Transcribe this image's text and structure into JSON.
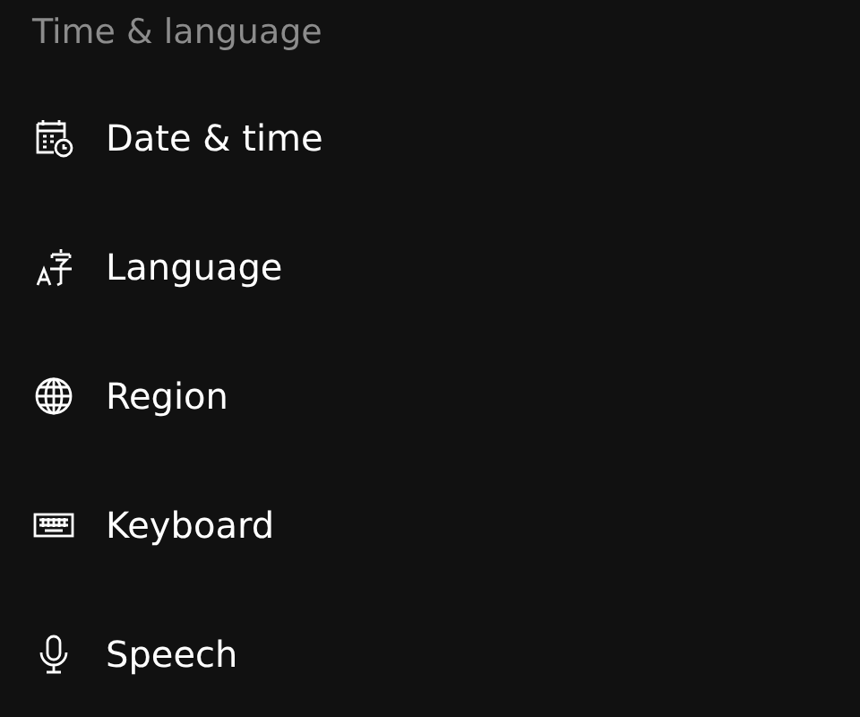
{
  "header": {
    "title": "Time & language"
  },
  "items": [
    {
      "kind": "calendar",
      "label": "Date & time"
    },
    {
      "kind": "language",
      "label": "Language"
    },
    {
      "kind": "globe",
      "label": "Region"
    },
    {
      "kind": "keyboard",
      "label": "Keyboard"
    },
    {
      "kind": "microphone",
      "label": "Speech"
    }
  ]
}
